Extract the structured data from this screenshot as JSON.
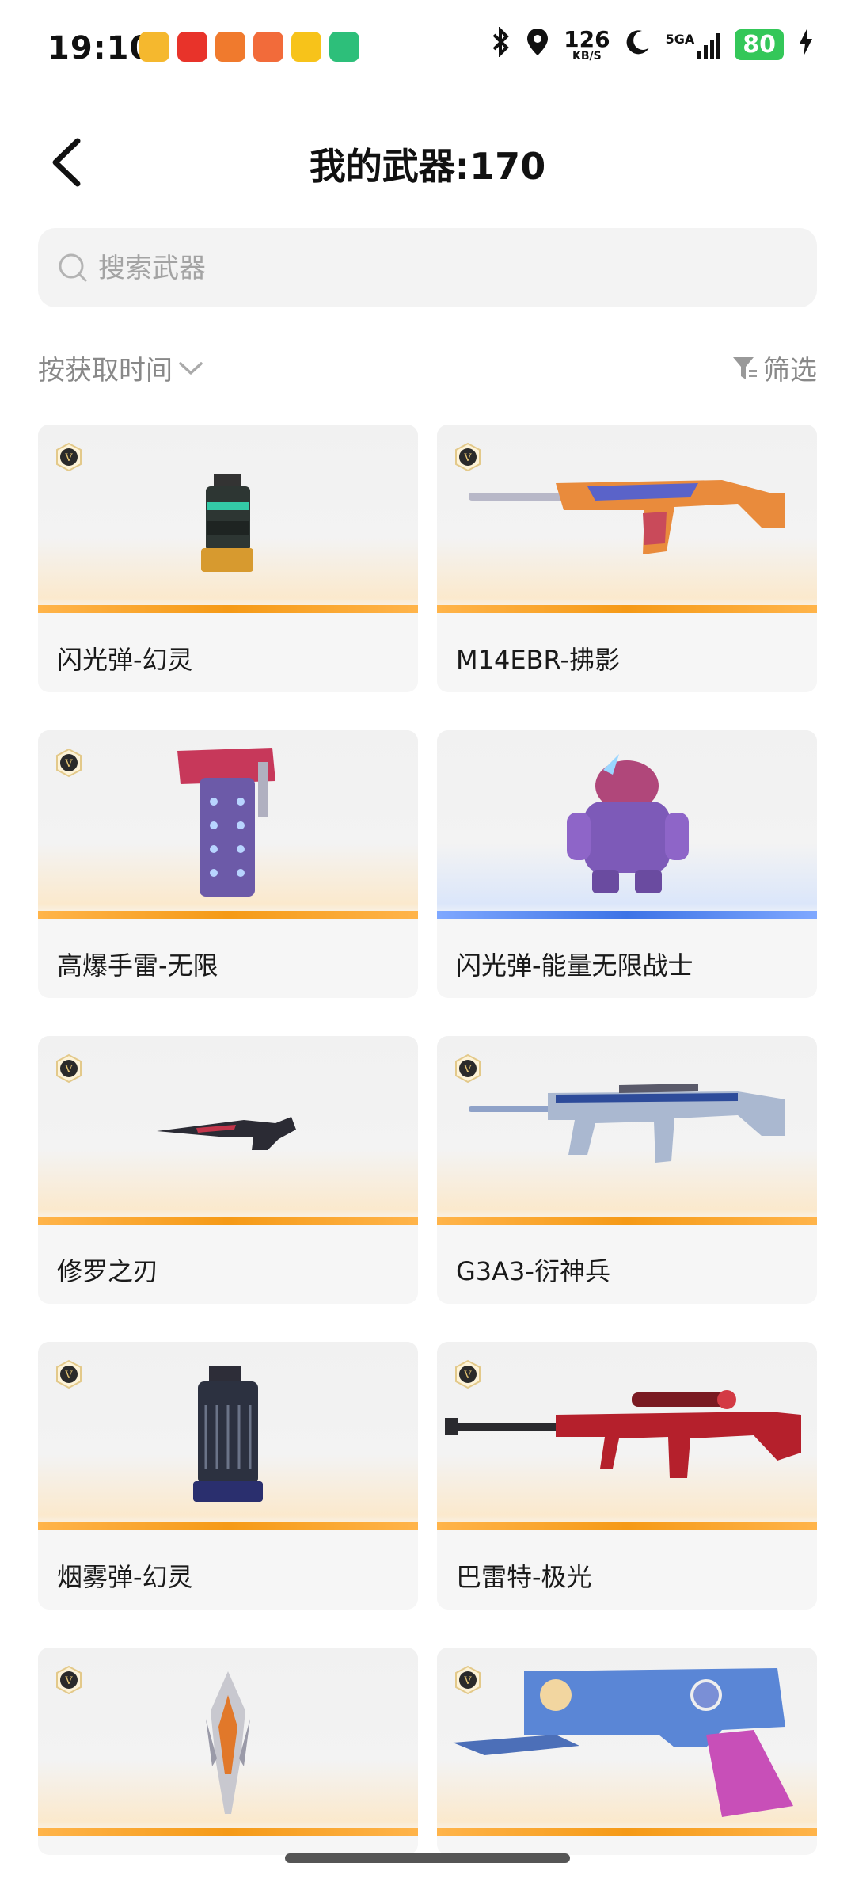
{
  "status_bar": {
    "time": "19:10",
    "net_speed": "126",
    "net_unit": "KB/S",
    "network": "5GA",
    "battery": "80"
  },
  "header": {
    "title": "我的武器:170"
  },
  "search": {
    "placeholder": "搜索武器"
  },
  "sort": {
    "label": "按获取时间"
  },
  "filter": {
    "label": "筛选"
  },
  "weapons": [
    {
      "name": "闪光弹-幻灵",
      "rarity_color": "#f59a17",
      "icon": "grenade-canister"
    },
    {
      "name": "M14EBR-拂影",
      "rarity_color": "#f59a17",
      "icon": "rifle"
    },
    {
      "name": "高爆手雷-无限",
      "rarity_color": "#f59a17",
      "icon": "grenade-canister"
    },
    {
      "name": "闪光弹-能量无限战士",
      "rarity_color": "#3d73e6",
      "icon": "robot-figure"
    },
    {
      "name": "修罗之刃",
      "rarity_color": "#f59a17",
      "icon": "knife"
    },
    {
      "name": "G3A3-衍神兵",
      "rarity_color": "#f59a17",
      "icon": "rifle"
    },
    {
      "name": "烟雾弹-幻灵",
      "rarity_color": "#f59a17",
      "icon": "grenade-canister"
    },
    {
      "name": "巴雷特-极光",
      "rarity_color": "#f59a17",
      "icon": "sniper-rifle"
    },
    {
      "name": "",
      "rarity_color": "#f59a17",
      "icon": "blade-emblem"
    },
    {
      "name": "",
      "rarity_color": "#f59a17",
      "icon": "pistol"
    }
  ]
}
